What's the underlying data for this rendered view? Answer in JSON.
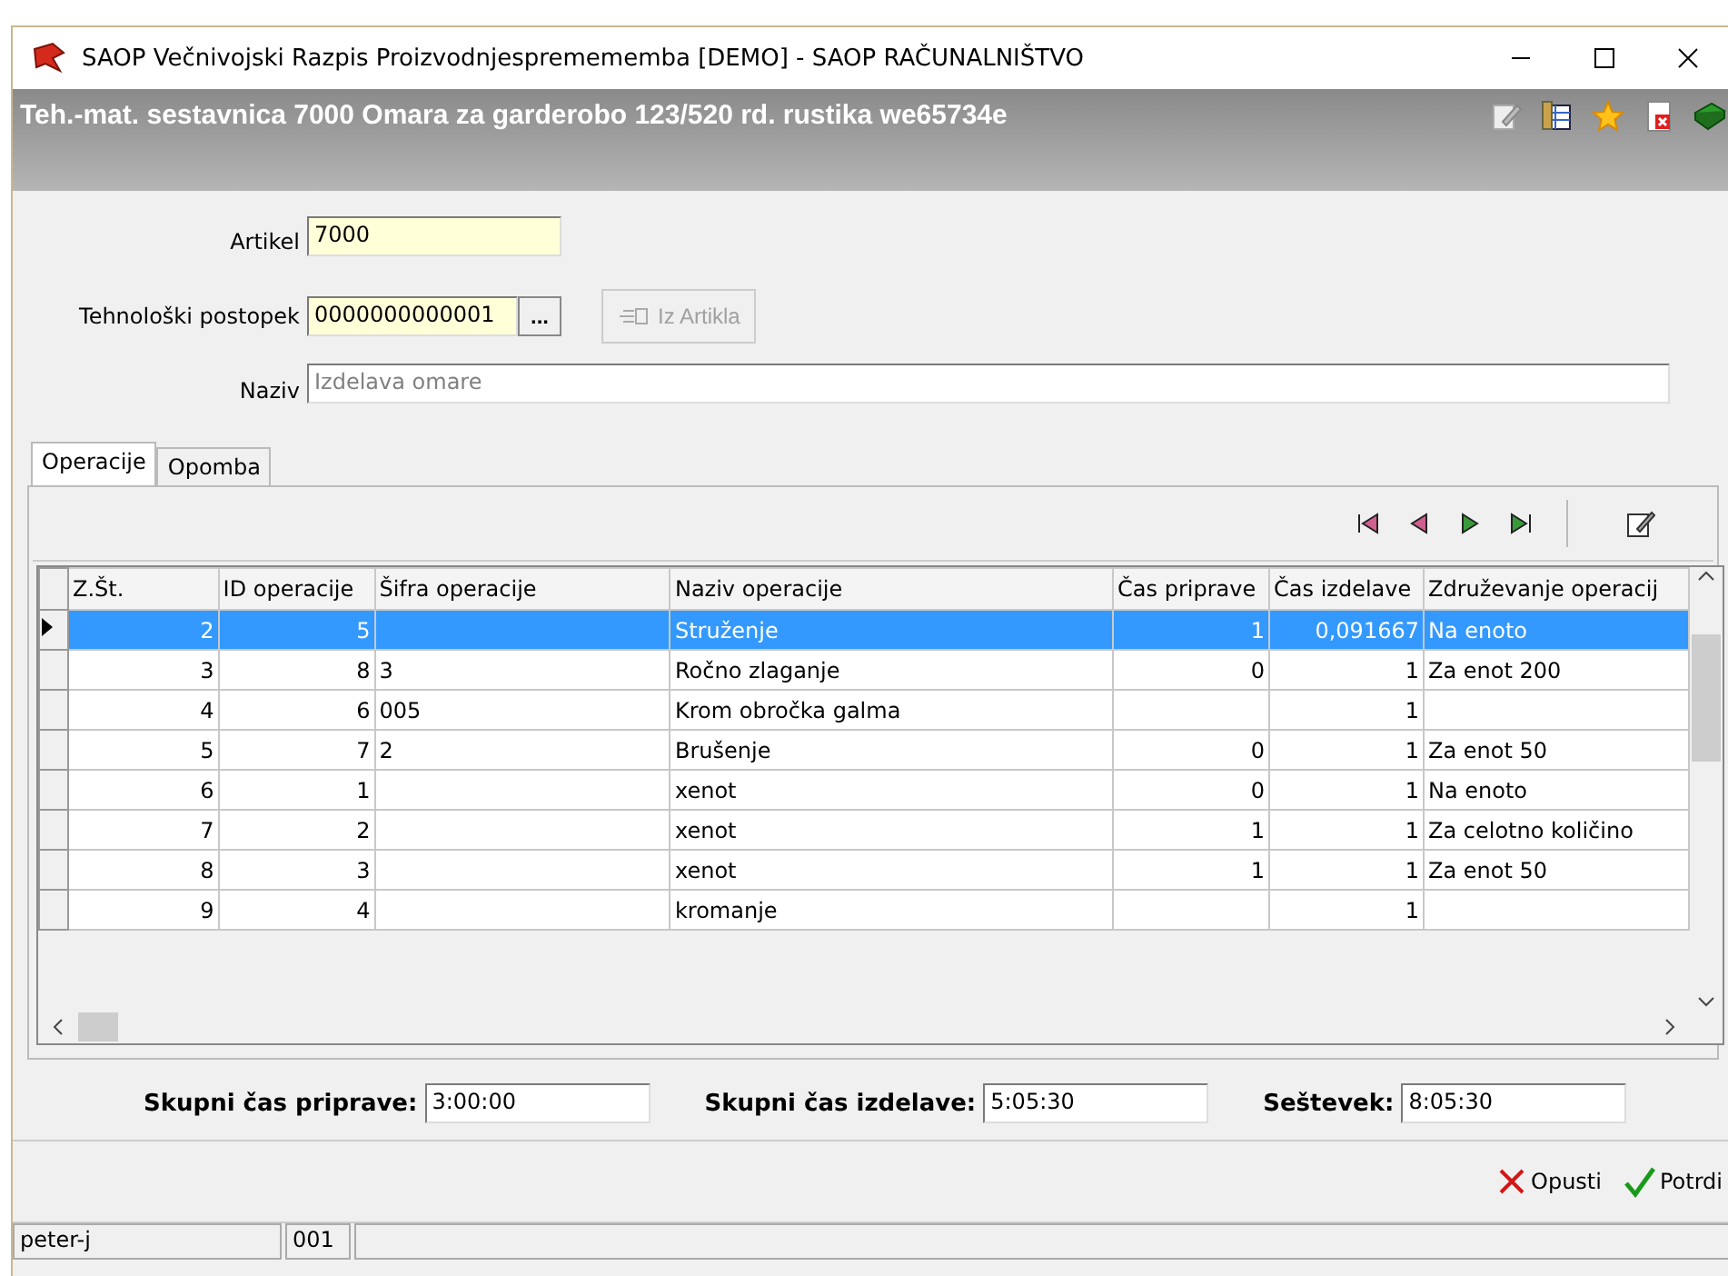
{
  "window": {
    "title": "SAOP   Večnivojski Razpis Proizvodnjespremememba [DEMO] - SAOP RAČUNALNIŠTVO"
  },
  "header": {
    "title": "Teh.-mat. sestavnica 7000 Omara za garderobo 123/520 rd. rustika  we65734e"
  },
  "form": {
    "artikel": {
      "label": "Artikel",
      "value": "7000"
    },
    "postopek": {
      "label": "Tehnološki postopek",
      "value": "0000000000001",
      "browse": "...",
      "from_article_button": "Iz Artikla",
      "from_article_disabled": true
    },
    "naziv": {
      "label": "Naziv",
      "value": "Izdelava omare",
      "disabled": true
    }
  },
  "tabs": [
    {
      "label": "Operacije",
      "selected": true
    },
    {
      "label": "Opomba",
      "selected": false
    }
  ],
  "table": {
    "columns": [
      "Z.Št.",
      "ID operacije",
      "Šifra operacije",
      "Naziv operacije",
      "Čas priprave",
      "Čas izdelave",
      "Združevanje operacij"
    ],
    "rows": [
      {
        "cells": [
          "2",
          "5",
          "",
          "Struženje",
          "1",
          "0,091667",
          "Na enoto"
        ],
        "selected": true
      },
      {
        "cells": [
          "3",
          "8",
          "3",
          "Ročno zlaganje",
          "0",
          "1",
          "Za enot 200"
        ],
        "selected": false
      },
      {
        "cells": [
          "4",
          "6",
          "005",
          "Krom obročka galma",
          "",
          "1",
          ""
        ],
        "selected": false
      },
      {
        "cells": [
          "5",
          "7",
          "2",
          "Brušenje",
          "0",
          "1",
          "Za enot 50"
        ],
        "selected": false
      },
      {
        "cells": [
          "6",
          "1",
          "",
          "xenot",
          "0",
          "1",
          "Na enoto"
        ],
        "selected": false
      },
      {
        "cells": [
          "7",
          "2",
          "",
          "xenot",
          "1",
          "1",
          "Za celotno količino"
        ],
        "selected": false
      },
      {
        "cells": [
          "8",
          "3",
          "",
          "xenot",
          "1",
          "1",
          "Za enot 50"
        ],
        "selected": false
      },
      {
        "cells": [
          "9",
          "4",
          "",
          "kromanje",
          "",
          "1",
          ""
        ],
        "selected": false
      }
    ]
  },
  "totals": [
    {
      "label": "Skupni čas priprave:",
      "value": "3:00:00"
    },
    {
      "label": "Skupni čas izdelave:",
      "value": "5:05:30"
    },
    {
      "label": "Seštevek:",
      "value": "8:05:30"
    }
  ],
  "buttons": [
    {
      "label": "Opusti",
      "kind": "cancel"
    },
    {
      "label": "Potrdi",
      "kind": "ok"
    }
  ],
  "status_bar": [
    "peter-j",
    "001"
  ]
}
